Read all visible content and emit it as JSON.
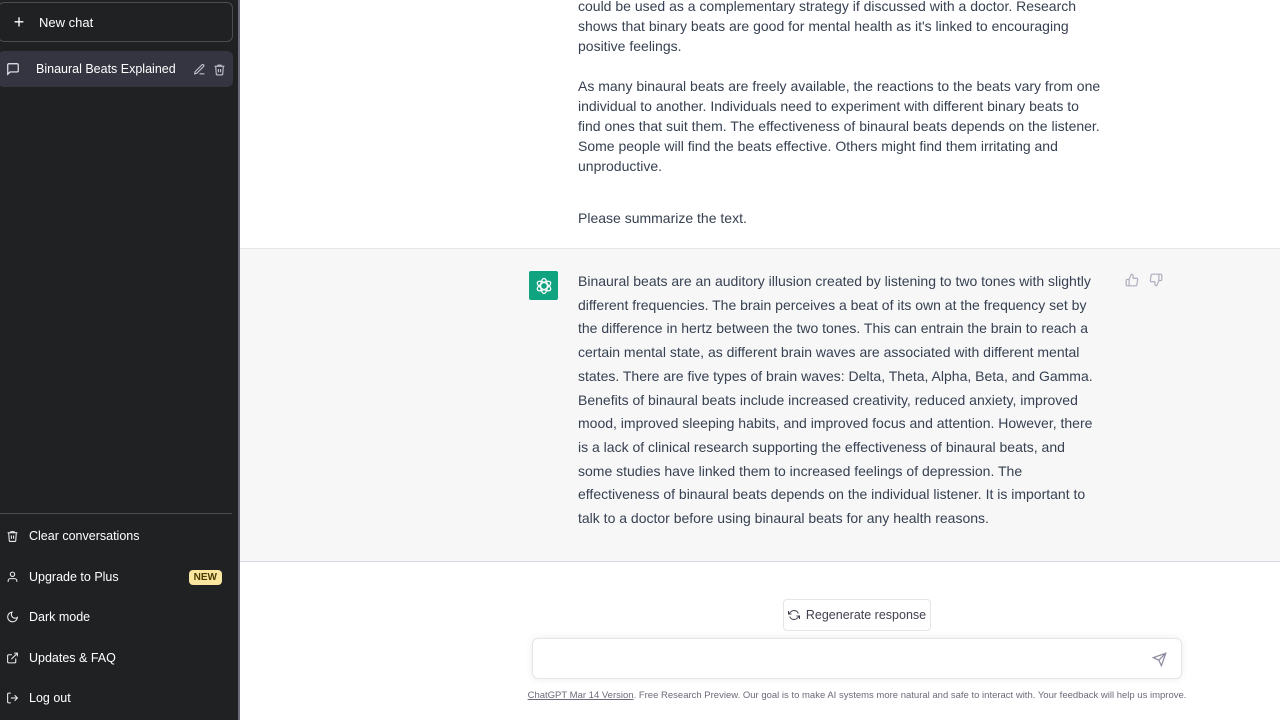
{
  "sidebar": {
    "new_chat_label": "New chat",
    "conversations": [
      {
        "title": "Binaural Beats Explained",
        "active": true
      }
    ],
    "footer_items": [
      {
        "label": "Clear conversations",
        "icon": "trash-icon"
      },
      {
        "label": "Upgrade to Plus",
        "icon": "user-icon",
        "badge": "NEW"
      },
      {
        "label": "Dark mode",
        "icon": "moon-icon"
      },
      {
        "label": "Updates & FAQ",
        "icon": "external-link-icon"
      },
      {
        "label": "Log out",
        "icon": "logout-icon"
      }
    ]
  },
  "conversation": {
    "user_message": {
      "paragraphs": [
        "could be used as a complementary strategy if discussed with a doctor. Research shows that binary beats are good for mental health as it's linked to encouraging positive feelings.",
        "As many binaural beats are freely available, the reactions to the beats vary from one individual to another. Individuals need to experiment with different binary beats to find ones that suit them. The effectiveness of binaural beats depends on the listener. Some people will find the beats effective. Others might find them irritating and unproductive.",
        "Please summarize the text."
      ]
    },
    "assistant_message": {
      "text": "Binaural beats are an auditory illusion created by listening to two tones with slightly different frequencies. The brain perceives a beat of its own at the frequency set by the difference in hertz between the two tones. This can entrain the brain to reach a certain mental state, as different brain waves are associated with different mental states. There are five types of brain waves: Delta, Theta, Alpha, Beta, and Gamma. Benefits of binaural beats include increased creativity, reduced anxiety, improved mood, improved sleeping habits, and improved focus and attention. However, there is a lack of clinical research supporting the effectiveness of binaural beats, and some studies have linked them to increased feelings of depression. The effectiveness of binaural beats depends on the individual listener. It is important to talk to a doctor before using binaural beats for any health reasons."
    }
  },
  "composer": {
    "regenerate_label": "Regenerate response",
    "input_value": "",
    "input_placeholder": ""
  },
  "footer": {
    "version_link": "ChatGPT Mar 14 Version",
    "disclaimer": ". Free Research Preview. Our goal is to make AI systems more natural and safe to interact with. Your feedback will help us improve."
  },
  "colors": {
    "sidebar_bg": "#202123",
    "active_item_bg": "#343541",
    "assistant_avatar": "#10a37f",
    "badge_bg": "#fae69e",
    "assistant_bg": "#f7f7f8"
  }
}
